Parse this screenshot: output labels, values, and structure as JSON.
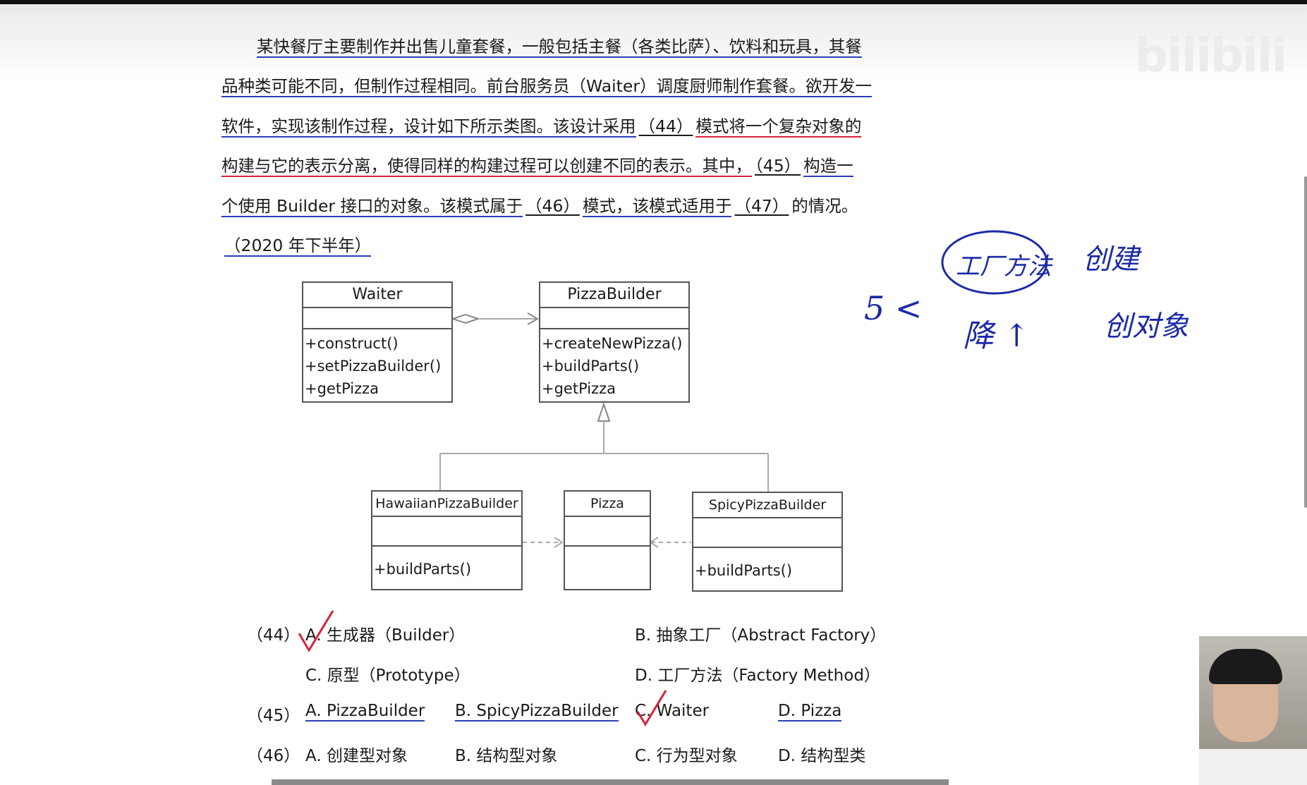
{
  "branding": {
    "logo_text": "bilibili"
  },
  "question": {
    "line1": "某快餐厅主要制作并出售儿童套餐，一般包括主餐（各类比萨）、饮料和玩具，其餐",
    "line2": "品种类可能不同，但制作过程相同。前台服务员（Waiter）调度厨师制作套餐。欲开发一",
    "line3_a": "软件，实现该制作过程，设计如下所示类图。该设计采用",
    "blank_44": "（44）",
    "line3_b": "模式将一个复杂对象的",
    "line4_a": "构建与它的表示分离，使得同样的构建过程可以创建不同的表示。其中，",
    "blank_45": "（45）",
    "line4_b": "构造一",
    "line5_a": "个使用 Builder 接口的对象。该模式属于",
    "blank_46": "（46）",
    "line5_b": "模式，该模式适用于",
    "blank_47": "（47）",
    "line5_c": "的情况。",
    "source": "（2020 年下半年）"
  },
  "diagram": {
    "waiter": {
      "name": "Waiter",
      "ops": [
        "+construct()",
        "+setPizzaBuilder()",
        "+getPizza"
      ]
    },
    "pizza_builder": {
      "name": "PizzaBuilder",
      "ops": [
        "+createNewPizza()",
        "+buildParts()",
        "+getPizza"
      ]
    },
    "hawaiian": {
      "name": "HawaiianPizzaBuilder",
      "ops": [
        "+buildParts()"
      ]
    },
    "pizza": {
      "name": "Pizza",
      "ops": []
    },
    "spicy": {
      "name": "SpicyPizzaBuilder",
      "ops": [
        "+buildParts()"
      ]
    }
  },
  "options": {
    "q44": {
      "num": "（44）",
      "a": "A. 生成器（Builder）",
      "b": "B. 抽象工厂（Abstract Factory）",
      "c": "C. 原型（Prototype）",
      "d": "D. 工厂方法（Factory Method）"
    },
    "q45": {
      "num": "（45）",
      "a": "A. PizzaBuilder",
      "b": "B. SpicyPizzaBuilder",
      "c": "C. Waiter",
      "d": "D. Pizza"
    },
    "q46": {
      "num": "（46）",
      "a": "A. 创建型对象",
      "b": "B. 结构型对象",
      "c": "C. 行为型对象",
      "d": "D. 结构型类"
    }
  },
  "annotations": {
    "circled": "工厂方法",
    "note_create": "创建",
    "note_five": "5 <",
    "note_down": "降 ↑",
    "note_create_obj": "创对象",
    "ink_color": "#1b2aa8",
    "check_color": "#d8213a"
  }
}
